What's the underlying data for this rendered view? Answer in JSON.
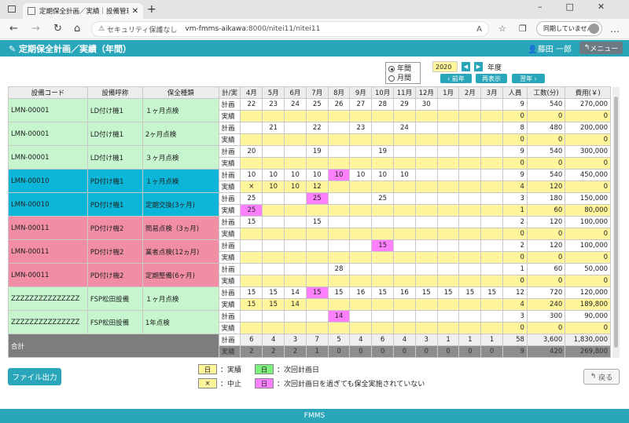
{
  "browser": {
    "tab_title": "定期保全計画／実績｜設備管理",
    "url_secure": "セキュリティ保護なし",
    "url_host": "vm-fmms-aikawa",
    "url_rest": ":8000/nitei11/nitei11",
    "profile": "同期していません",
    "icons": {
      "back": "back-arrow-icon",
      "forward": "forward-arrow-icon",
      "reload": "reload-icon",
      "home": "home-icon"
    }
  },
  "app": {
    "title": "定期保全計画／実績（年間）",
    "user": "藤田 一郎",
    "menu": "メニュー"
  },
  "controls": {
    "radio_year": "年間",
    "radio_month": "月間",
    "year": "2020",
    "year_suffix": "年度",
    "prev": "前年",
    "redisplay": "再表示",
    "next": "翌年"
  },
  "table": {
    "headers": [
      "設備コード",
      "設備呼称",
      "保全種類",
      "計/実",
      "4月",
      "5月",
      "6月",
      "7月",
      "8月",
      "9月",
      "10月",
      "11月",
      "12月",
      "1月",
      "2月",
      "3月",
      "人員",
      "工数(分)",
      "費用(￥)"
    ],
    "plan_label": "計画",
    "actual_label": "実績",
    "rows": [
      {
        "code": "LMN-00001",
        "name": "LD付け機1",
        "type": "１ヶ月点検",
        "plan": [
          "22",
          "23",
          "24",
          "25",
          "26",
          "27",
          "28",
          "29",
          "30",
          "",
          "",
          ""
        ],
        "actual": [
          "",
          "",
          "",
          "",
          "",
          "",
          "",
          "",
          "",
          "",
          "",
          ""
        ],
        "plan_staff": "9",
        "plan_hours": "540",
        "plan_cost": "270,000",
        "act_staff": "0",
        "act_hours": "0",
        "act_cost": "0"
      },
      {
        "code": "LMN-00001",
        "name": "LD付け機1",
        "type": "2ヶ月点検",
        "plan": [
          "",
          "21",
          "",
          "22",
          "",
          "23",
          "",
          "24",
          "",
          "",
          "",
          ""
        ],
        "actual": [
          "",
          "",
          "",
          "",
          "",
          "",
          "",
          "",
          "",
          "",
          "",
          ""
        ],
        "plan_staff": "8",
        "plan_hours": "480",
        "plan_cost": "200,000",
        "act_staff": "0",
        "act_hours": "0",
        "act_cost": "0"
      },
      {
        "code": "LMN-00001",
        "name": "LD付け機1",
        "type": "３ヶ月点検",
        "plan": [
          "20",
          "",
          "",
          "19",
          "",
          "",
          "19",
          "",
          "",
          "",
          "",
          ""
        ],
        "actual": [
          "",
          "",
          "",
          "",
          "",
          "",
          "",
          "",
          "",
          "",
          "",
          ""
        ],
        "plan_staff": "9",
        "plan_hours": "540",
        "plan_cost": "300,000",
        "act_staff": "0",
        "act_hours": "0",
        "act_cost": "0"
      },
      {
        "code": "LMN-00010",
        "name": "PD付け機1",
        "type": "１ヶ月点検",
        "plan": [
          "10",
          "10",
          "10",
          "10",
          "10",
          "10",
          "10",
          "10",
          "",
          "",
          "",
          ""
        ],
        "actual": [
          "×",
          "10",
          "10",
          "12",
          "",
          "",
          "",
          "",
          "",
          "",
          "",
          ""
        ],
        "plan_staff": "9",
        "plan_hours": "540",
        "plan_cost": "450,000",
        "act_staff": "4",
        "act_hours": "120",
        "act_cost": "0"
      },
      {
        "code": "LMN-00010",
        "name": "PD付け機1",
        "type": "定期交換(3ヶ月)",
        "plan": [
          "25",
          "",
          "",
          "25",
          "",
          "",
          "25",
          "",
          "",
          "",
          "",
          ""
        ],
        "actual": [
          "25",
          "",
          "",
          "",
          "",
          "",
          "",
          "",
          "",
          "",
          "",
          ""
        ],
        "plan_staff": "3",
        "plan_hours": "180",
        "plan_cost": "150,000",
        "act_staff": "1",
        "act_hours": "60",
        "act_cost": "80,000"
      },
      {
        "code": "LMN-00011",
        "name": "PD付け機2",
        "type": "簡易点検（3ヵ月)",
        "plan": [
          "15",
          "",
          "",
          "15",
          "",
          "",
          "",
          "",
          "",
          "",
          "",
          ""
        ],
        "actual": [
          "",
          "",
          "",
          "",
          "",
          "",
          "",
          "",
          "",
          "",
          "",
          ""
        ],
        "plan_staff": "2",
        "plan_hours": "120",
        "plan_cost": "100,000",
        "act_staff": "0",
        "act_hours": "0",
        "act_cost": "0"
      },
      {
        "code": "LMN-00011",
        "name": "PD付け機2",
        "type": "業者点検(12ヵ月)",
        "plan": [
          "",
          "",
          "",
          "",
          "",
          "",
          "15",
          "",
          "",
          "",
          "",
          ""
        ],
        "actual": [
          "",
          "",
          "",
          "",
          "",
          "",
          "",
          "",
          "",
          "",
          "",
          ""
        ],
        "plan_staff": "2",
        "plan_hours": "120",
        "plan_cost": "100,000",
        "act_staff": "0",
        "act_hours": "0",
        "act_cost": "0"
      },
      {
        "code": "LMN-00011",
        "name": "PD付け機2",
        "type": "定期整備(6ヶ月)",
        "plan": [
          "",
          "",
          "",
          "",
          "28",
          "",
          "",
          "",
          "",
          "",
          "",
          ""
        ],
        "actual": [
          "",
          "",
          "",
          "",
          "",
          "",
          "",
          "",
          "",
          "",
          "",
          ""
        ],
        "plan_staff": "1",
        "plan_hours": "60",
        "plan_cost": "50,000",
        "act_staff": "0",
        "act_hours": "0",
        "act_cost": "0"
      },
      {
        "code": "ZZZZZZZZZZZZZZZ",
        "name": "FSP松田設備",
        "type": "１ヶ月点検",
        "plan": [
          "15",
          "15",
          "14",
          "15",
          "15",
          "16",
          "15",
          "16",
          "15",
          "15",
          "15",
          "15"
        ],
        "actual": [
          "15",
          "15",
          "14",
          "",
          "",
          "",
          "",
          "",
          "",
          "",
          "",
          ""
        ],
        "plan_staff": "12",
        "plan_hours": "720",
        "plan_cost": "120,000",
        "act_staff": "4",
        "act_hours": "240",
        "act_cost": "189,800"
      },
      {
        "code": "ZZZZZZZZZZZZZZZ",
        "name": "FSP松田設備",
        "type": "1年点検",
        "plan": [
          "",
          "",
          "",
          "",
          "14",
          "",
          "",
          "",
          "",
          "",
          "",
          ""
        ],
        "actual": [
          "",
          "",
          "",
          "",
          "",
          "",
          "",
          "",
          "",
          "",
          "",
          ""
        ],
        "plan_staff": "3",
        "plan_hours": "300",
        "plan_cost": "90,000",
        "act_staff": "0",
        "act_hours": "0",
        "act_cost": "0"
      }
    ],
    "total": {
      "label": "合計",
      "plan": [
        "6",
        "4",
        "3",
        "7",
        "5",
        "4",
        "6",
        "4",
        "3",
        "1",
        "1",
        "1"
      ],
      "actual": [
        "2",
        "2",
        "2",
        "1",
        "0",
        "0",
        "0",
        "0",
        "0",
        "0",
        "0",
        "0"
      ],
      "plan_staff": "58",
      "plan_hours": "3,600",
      "plan_cost": "1,830,000",
      "act_staff": "9",
      "act_hours": "420",
      "act_cost": "269,800"
    }
  },
  "buttons": {
    "file_out": "ファイル出力",
    "back": "戻る"
  },
  "legend": {
    "actual_box": "日",
    "actual_text": "：実績",
    "next_box": "日",
    "next_text": "：次回計画日",
    "cancel_box": "×",
    "cancel_text": "：中止",
    "overdue_box": "日",
    "overdue_text": "：次回計画日を過ぎても保全実施されていない"
  },
  "colors": {
    "accent": "#2aa6ba",
    "actual_bg": "#fff59a",
    "next_bg": "#7ff07f",
    "overdue_bg": "#ff80ff"
  },
  "footer": "FMMS"
}
